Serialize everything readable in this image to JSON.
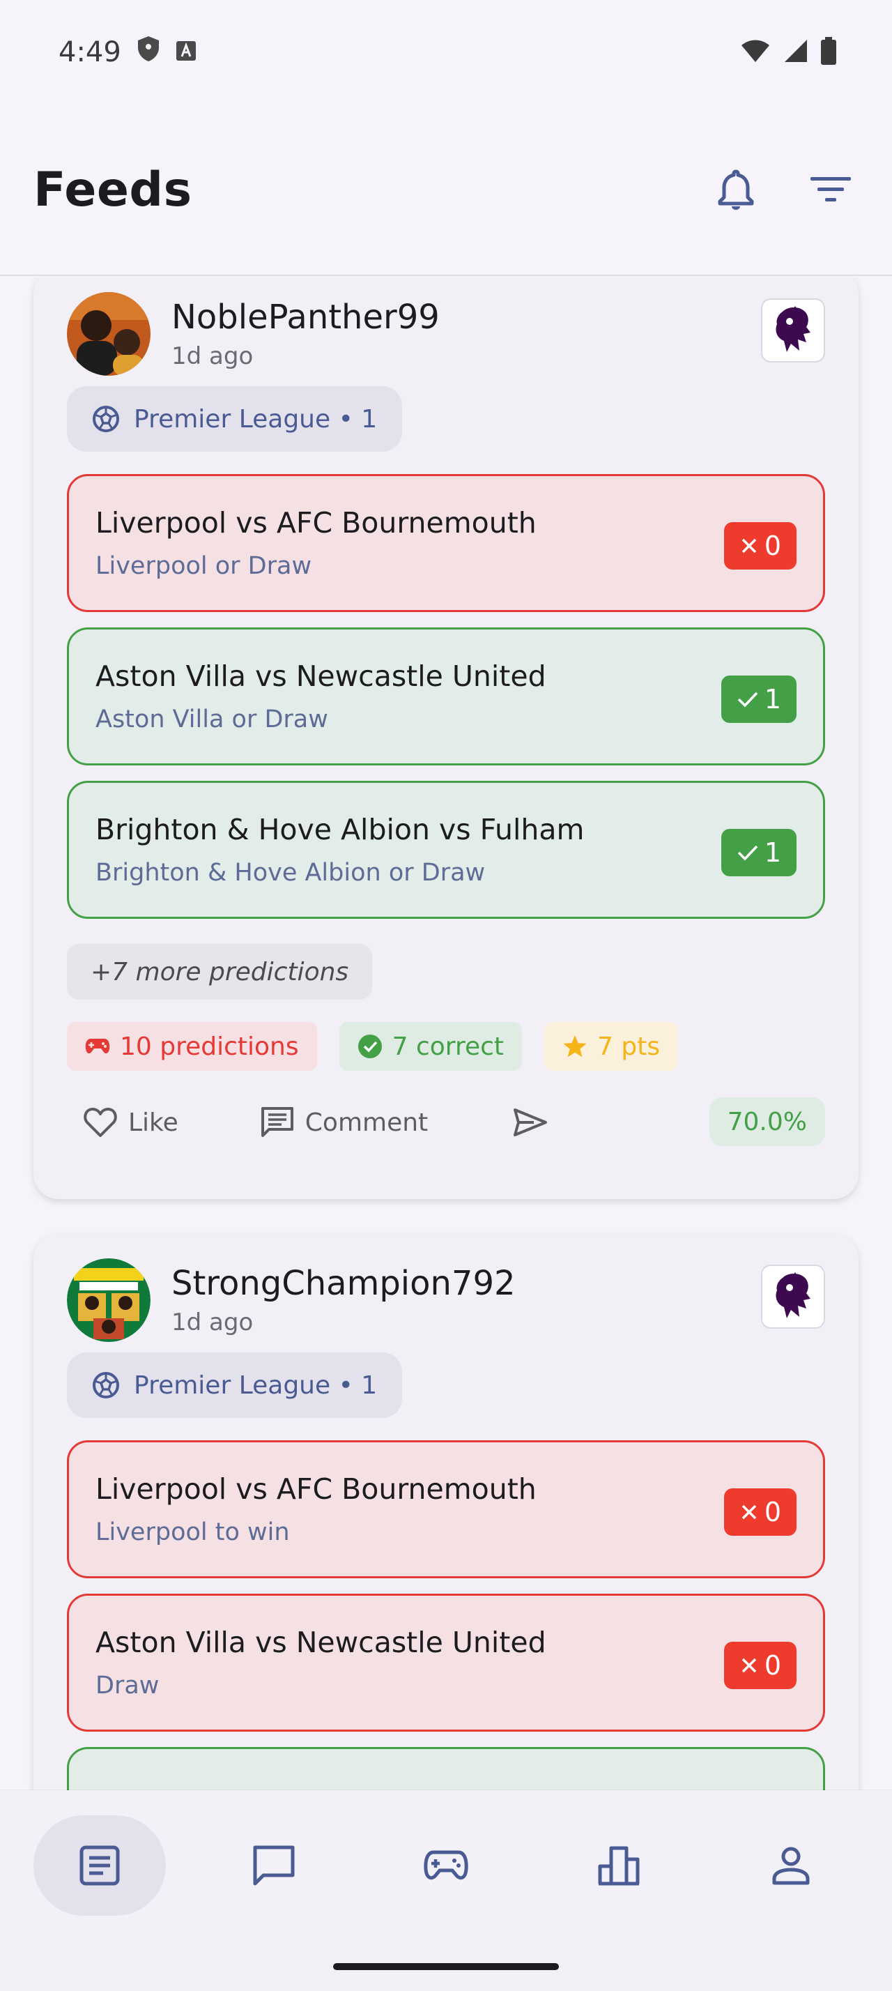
{
  "status_bar": {
    "time": "4:49"
  },
  "header": {
    "title": "Feeds"
  },
  "posts": [
    {
      "username": "NoblePanther99",
      "time_ago": "1d ago",
      "league_chip": "Premier League • 1",
      "matches": [
        {
          "title": "Liverpool vs AFC Bournemouth",
          "pick": "Liverpool or Draw",
          "result": "lost",
          "points": "0"
        },
        {
          "title": "Aston Villa vs Newcastle United",
          "pick": "Aston Villa or Draw",
          "result": "won",
          "points": "1"
        },
        {
          "title": "Brighton & Hove Albion vs Fulham",
          "pick": "Brighton & Hove Albion or Draw",
          "result": "won",
          "points": "1"
        }
      ],
      "more_predictions": "+7 more predictions",
      "stats": {
        "predictions": "10 predictions",
        "correct": "7 correct",
        "points": "7 pts"
      },
      "actions": {
        "like": "Like",
        "comment": "Comment"
      },
      "accuracy": "70.0%"
    },
    {
      "username": "StrongChampion792",
      "time_ago": "1d ago",
      "league_chip": "Premier League • 1",
      "matches": [
        {
          "title": "Liverpool vs AFC Bournemouth",
          "pick": "Liverpool to win",
          "result": "lost",
          "points": "0"
        },
        {
          "title": "Aston Villa vs Newcastle United",
          "pick": "Draw",
          "result": "lost",
          "points": "0"
        }
      ]
    }
  ],
  "colors": {
    "lost": "#e53935",
    "won": "#43a047",
    "accent": "#4a5a92",
    "league_purple": "#3d0a4f"
  },
  "nav": {
    "items": [
      "feeds-icon",
      "chat-icon",
      "games-icon",
      "leaderboard-icon",
      "profile-icon"
    ],
    "active": "feeds-icon"
  }
}
